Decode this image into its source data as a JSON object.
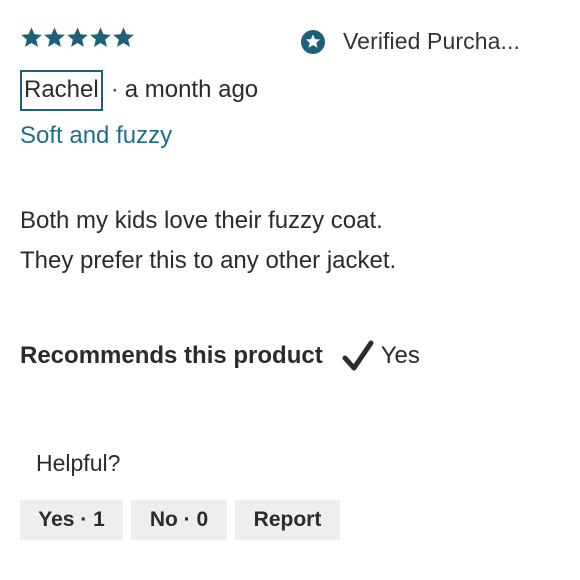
{
  "rating": {
    "stars": 5,
    "max": 5,
    "color": "#1e5f7a"
  },
  "verified": {
    "icon": "verified-star-badge-icon",
    "label": "Verified Purcha..."
  },
  "author": {
    "name": "Rachel",
    "separator": "·",
    "time": "a month ago"
  },
  "title": "Soft and fuzzy",
  "body": {
    "lines": [
      "Both my kids love their fuzzy coat.",
      "They prefer this to any other jacket."
    ]
  },
  "recommends": {
    "label": "Recommends this product",
    "icon": "checkmark-icon",
    "value": "Yes"
  },
  "helpful": {
    "label": "Helpful?",
    "yes_label": "Yes · 1",
    "no_label": "No · 0",
    "report_label": "Report"
  },
  "colors": {
    "accent": "#1e5f7a",
    "title": "#1f6e8c",
    "text": "#2b2b2b",
    "button_bg": "#eeeeee"
  }
}
